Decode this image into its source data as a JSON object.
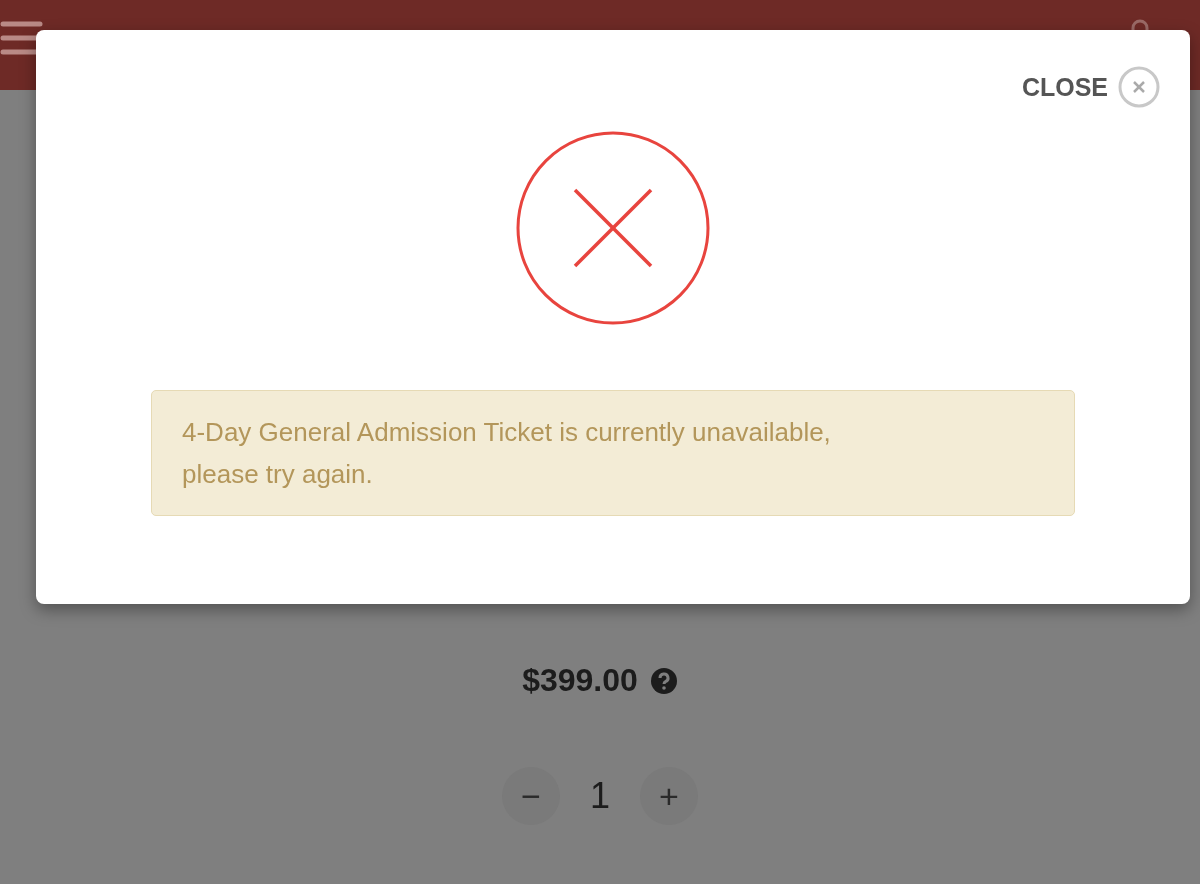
{
  "page": {
    "price": "$399.00",
    "quantity": {
      "decrease": "−",
      "value": "1",
      "increase": "+"
    }
  },
  "modal": {
    "close_label": "CLOSE",
    "message": "4-Day General Admission Ticket is currently unavailable, please try again."
  }
}
